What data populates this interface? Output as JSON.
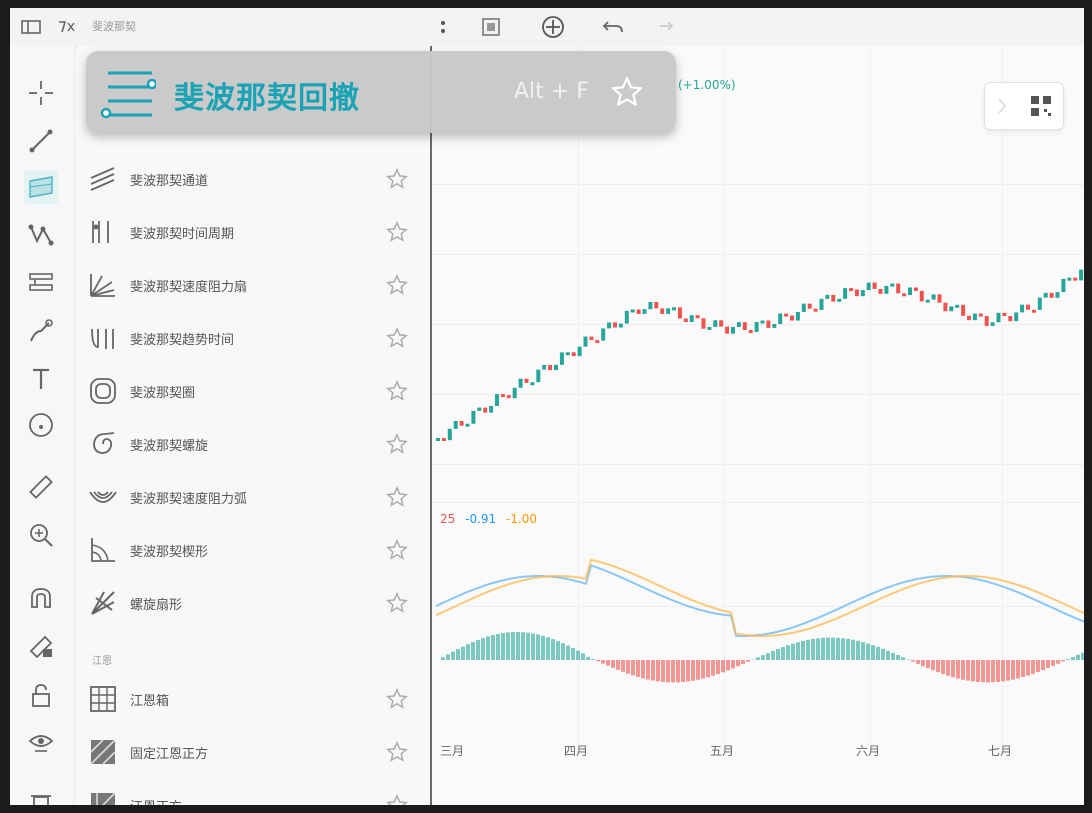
{
  "tooltip": {
    "title": "斐波那契回撤",
    "shortcut": "Alt + F",
    "icon": "fib-retracement-icon",
    "favorite_icon": "star-outline-icon"
  },
  "topbar": {
    "icons": [
      "layout-icon",
      "indicator-icon",
      "templates-icon",
      "crosshair-icon",
      "undo-icon",
      "redo-icon"
    ],
    "label": "斐波那契"
  },
  "toolstrip": {
    "tools": [
      "crosshair-icon",
      "trendline-icon",
      "fib-icon",
      "pattern-icon",
      "prediction-icon",
      "brush-icon",
      "text-icon",
      "emoji-icon",
      "ruler-icon",
      "zoom-in-icon",
      "magnet-icon",
      "lock-drawing-icon",
      "lock-icon",
      "eye-icon",
      "trash-icon"
    ]
  },
  "flyout": {
    "items": [
      {
        "label": "斐波那契通道",
        "icon": "fib-channel-icon"
      },
      {
        "label": "斐波那契时间周期",
        "icon": "fib-time-zone-icon"
      },
      {
        "label": "斐波那契速度阻力扇",
        "icon": "fib-speed-fan-icon"
      },
      {
        "label": "斐波那契趋势时间",
        "icon": "fib-trend-time-icon"
      },
      {
        "label": "斐波那契圈",
        "icon": "fib-circles-icon"
      },
      {
        "label": "斐波那契螺旋",
        "icon": "fib-spiral-icon"
      },
      {
        "label": "斐波那契速度阻力弧",
        "icon": "fib-speed-arcs-icon"
      },
      {
        "label": "斐波那契楔形",
        "icon": "fib-wedge-icon"
      },
      {
        "label": "螺旋扇形",
        "icon": "pitchfan-icon"
      }
    ],
    "section_gann": "江恩",
    "gann_items": [
      {
        "label": "江恩箱",
        "icon": "gann-box-icon"
      },
      {
        "label": "固定江恩正方",
        "icon": "gann-square-fixed-icon"
      },
      {
        "label": "江恩正方",
        "icon": "gann-square-icon"
      }
    ]
  },
  "chart": {
    "top_badge": "(+1.00%)",
    "x_ticks": [
      "三月",
      "四月",
      "五月",
      "六月",
      "七月"
    ],
    "indicator_legend": [
      {
        "text": "25",
        "color": "#ef5350"
      },
      {
        "text": "-0.91",
        "color": "#2196f3"
      },
      {
        "text": "-1.00",
        "color": "#ff9800"
      }
    ],
    "colors": {
      "up": "#26a69a",
      "down": "#ef5350",
      "macd": "#64b5f6",
      "signal": "#ffb74d"
    }
  }
}
